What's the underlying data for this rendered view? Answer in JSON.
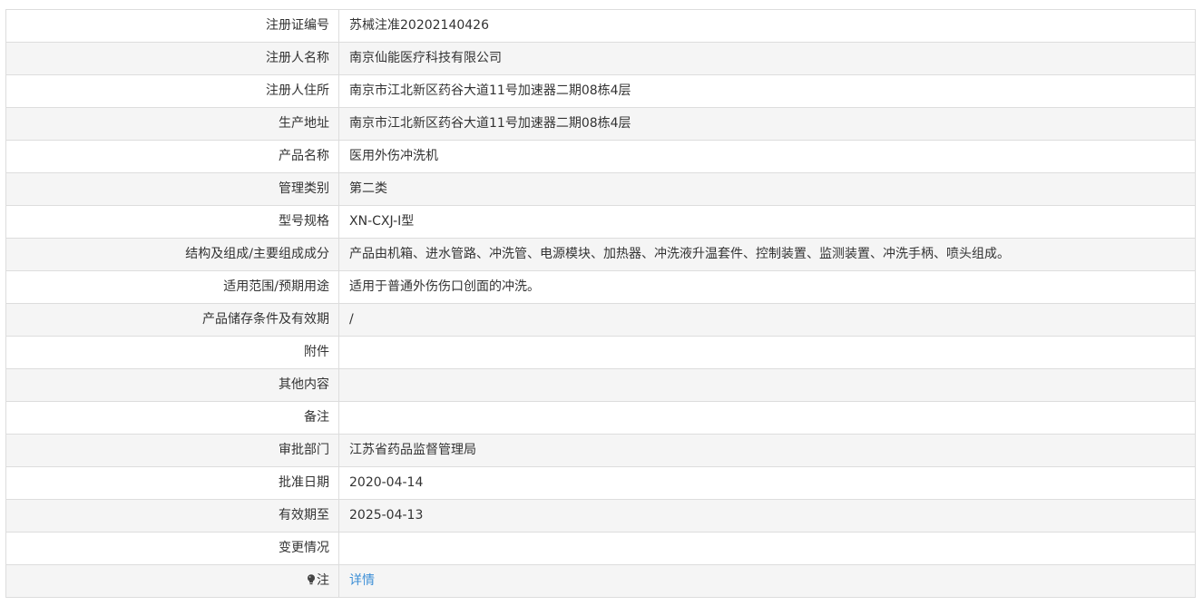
{
  "rows": [
    {
      "label": "注册证编号",
      "value": "苏械注准20202140426"
    },
    {
      "label": "注册人名称",
      "value": "南京仙能医疗科技有限公司"
    },
    {
      "label": "注册人住所",
      "value": "南京市江北新区药谷大道11号加速器二期08栋4层"
    },
    {
      "label": "生产地址",
      "value": "南京市江北新区药谷大道11号加速器二期08栋4层"
    },
    {
      "label": "产品名称",
      "value": "医用外伤冲洗机"
    },
    {
      "label": "管理类别",
      "value": "第二类"
    },
    {
      "label": "型号规格",
      "value": "XN-CXJ-I型"
    },
    {
      "label": "结构及组成/主要组成成分",
      "value": "产品由机箱、进水管路、冲洗管、电源模块、加热器、冲洗液升温套件、控制装置、监测装置、冲洗手柄、喷头组成。"
    },
    {
      "label": "适用范围/预期用途",
      "value": "适用于普通外伤伤口创面的冲洗。"
    },
    {
      "label": "产品储存条件及有效期",
      "value": "/"
    },
    {
      "label": "附件",
      "value": ""
    },
    {
      "label": "其他内容",
      "value": ""
    },
    {
      "label": "备注",
      "value": ""
    },
    {
      "label": "审批部门",
      "value": "江苏省药品监督管理局"
    },
    {
      "label": "批准日期",
      "value": "2020-04-14"
    },
    {
      "label": "有效期至",
      "value": "2025-04-13"
    },
    {
      "label": "变更情况",
      "value": ""
    }
  ],
  "note_row": {
    "icon": "lightbulb-icon",
    "label": "注",
    "link_text": "详情"
  },
  "colors": {
    "border": "#dddddd",
    "row_alt": "#f5f5f5",
    "text": "#333333",
    "link": "#3d8fd6"
  }
}
